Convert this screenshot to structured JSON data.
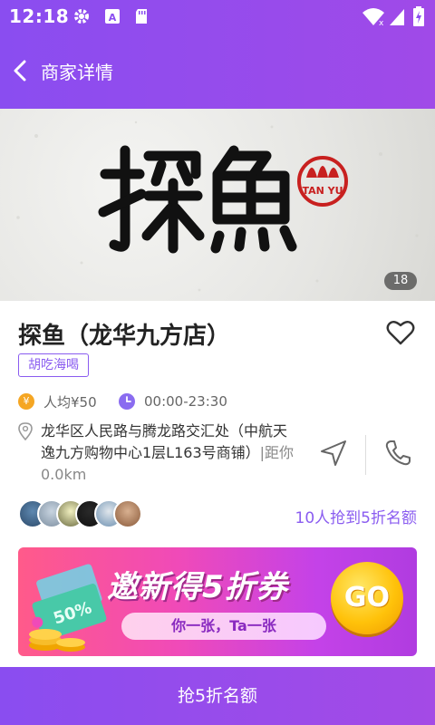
{
  "status_bar": {
    "time": "12:18"
  },
  "nav": {
    "title": "商家详情"
  },
  "hero": {
    "photo_count": "18"
  },
  "store": {
    "name": "探鱼（龙华九方店）",
    "tag": "胡吃海喝",
    "avg_price": "人均¥50",
    "hours": "00:00-23:30",
    "address": "龙华区人民路与腾龙路交汇处（中航天逸九方购物中心1层L163号商铺）",
    "distance": "|距你0.0km",
    "grab_count": "10人抢到5折名额"
  },
  "banner": {
    "title": "邀新得5折券",
    "subtitle": "你一张，Ta一张",
    "go_label": "GO"
  },
  "cta": {
    "label": "抢5折名额"
  },
  "colors": {
    "brand": "#8a4df0",
    "price_icon": "#f5a623",
    "clock_icon": "#8a6cf0"
  }
}
